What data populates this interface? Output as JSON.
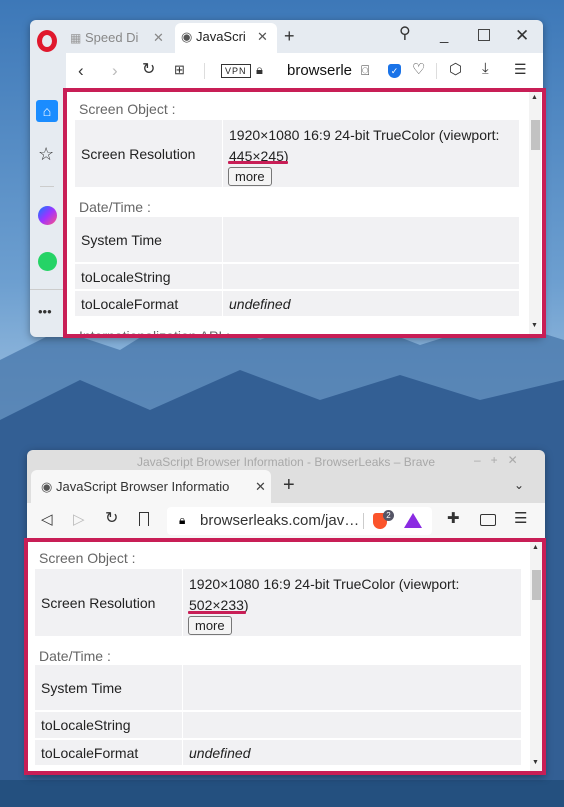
{
  "opera": {
    "tabs": [
      {
        "label": "Speed Di",
        "icon": "speed-dial-grid-icon"
      },
      {
        "label": "JavaScri",
        "icon": "fingerprint-icon",
        "active": true
      }
    ],
    "url": "browserle",
    "vpn_label": "VPN",
    "sidebar_icons": [
      "home-icon",
      "star-icon",
      "messenger-icon",
      "whatsapp-icon",
      "more-icon"
    ]
  },
  "brave": {
    "title": "JavaScript Browser Information - BrowserLeaks – Brave",
    "tab_label": "JavaScript Browser Informatio",
    "url": "browserleaks.com/jav…",
    "shields_badge": "2"
  },
  "content": {
    "screen_heading": "Screen Object :",
    "screen_resolution_label": "Screen Resolution",
    "resolution_text": "1920×1080 16:9 24-bit TrueColor (viewport:",
    "more_label": "more",
    "date_heading": "Date/Time :",
    "system_time_label": "System Time",
    "system_time_value": "",
    "to_locale_string_label": "toLocaleString",
    "to_locale_string_value": "",
    "to_locale_format_label": "toLocaleFormat",
    "to_locale_format_value": "undefined",
    "intl_heading": "Internationalization API :"
  },
  "opera_viewport": "445×245",
  "brave_viewport": "502×233",
  "colors": {
    "highlight": "#c81e56",
    "opera_red": "#e0182d",
    "brave_orange": "#fb542b"
  }
}
